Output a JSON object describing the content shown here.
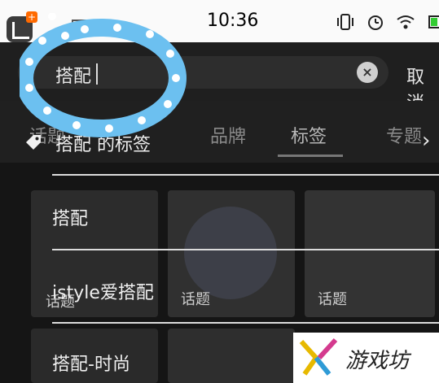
{
  "status_bar": {
    "time": "10:36"
  },
  "search": {
    "value": "搭配",
    "cancel_label": "取消"
  },
  "tabs": [
    {
      "label": "话题"
    },
    {
      "label": "品牌"
    },
    {
      "label": "标签"
    },
    {
      "label": "专题"
    }
  ],
  "suggestions": [
    {
      "label": "搭配 的标签"
    },
    {
      "label": "搭配"
    },
    {
      "label": "istyle爱搭配"
    },
    {
      "label": "搭配-时尚"
    }
  ],
  "background_cards": [
    {
      "label": "话题"
    },
    {
      "label": "话题"
    },
    {
      "label": "话题"
    }
  ],
  "watermark": {
    "text": "游戏坊"
  },
  "colors": {
    "accent_orange": "#ff6a00",
    "decoration_blue": "#6cc0f0",
    "battery_green": "#33cc33"
  }
}
